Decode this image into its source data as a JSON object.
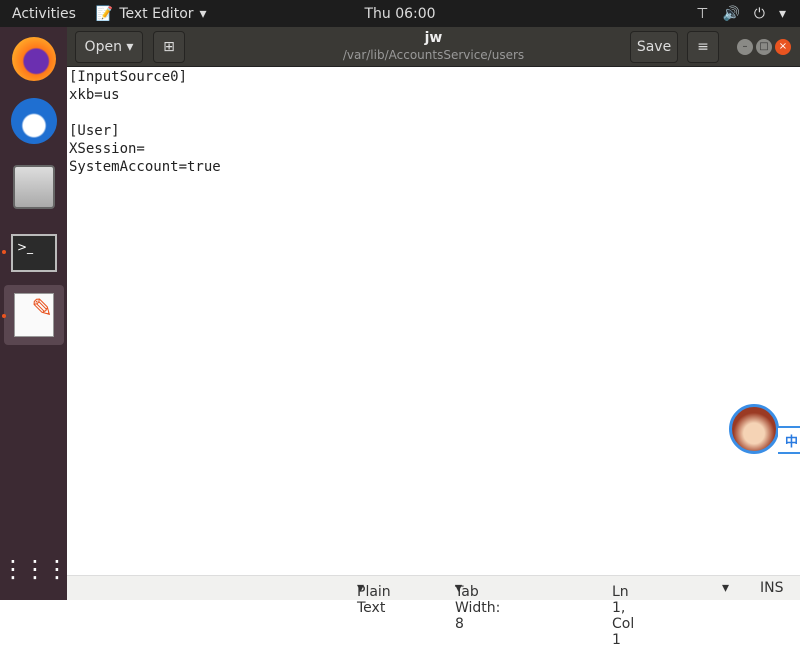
{
  "topbar": {
    "activities": "Activities",
    "app_name": "Text Editor",
    "clock": "Thu 06:00"
  },
  "header": {
    "open_label": "Open",
    "save_label": "Save",
    "title": "jw",
    "path": "/var/lib/AccountsService/users"
  },
  "editor": {
    "content": "[InputSource0]\nxkb=us\n\n[User]\nXSession=\nSystemAccount=true"
  },
  "status": {
    "language": "Plain Text",
    "tab_width": "Tab Width: 8",
    "position": "Ln 1, Col 1",
    "mode": "INS"
  },
  "ime": {
    "label": "中"
  },
  "colors": {
    "accent": "#e95420",
    "dock": "#3c2a33"
  }
}
